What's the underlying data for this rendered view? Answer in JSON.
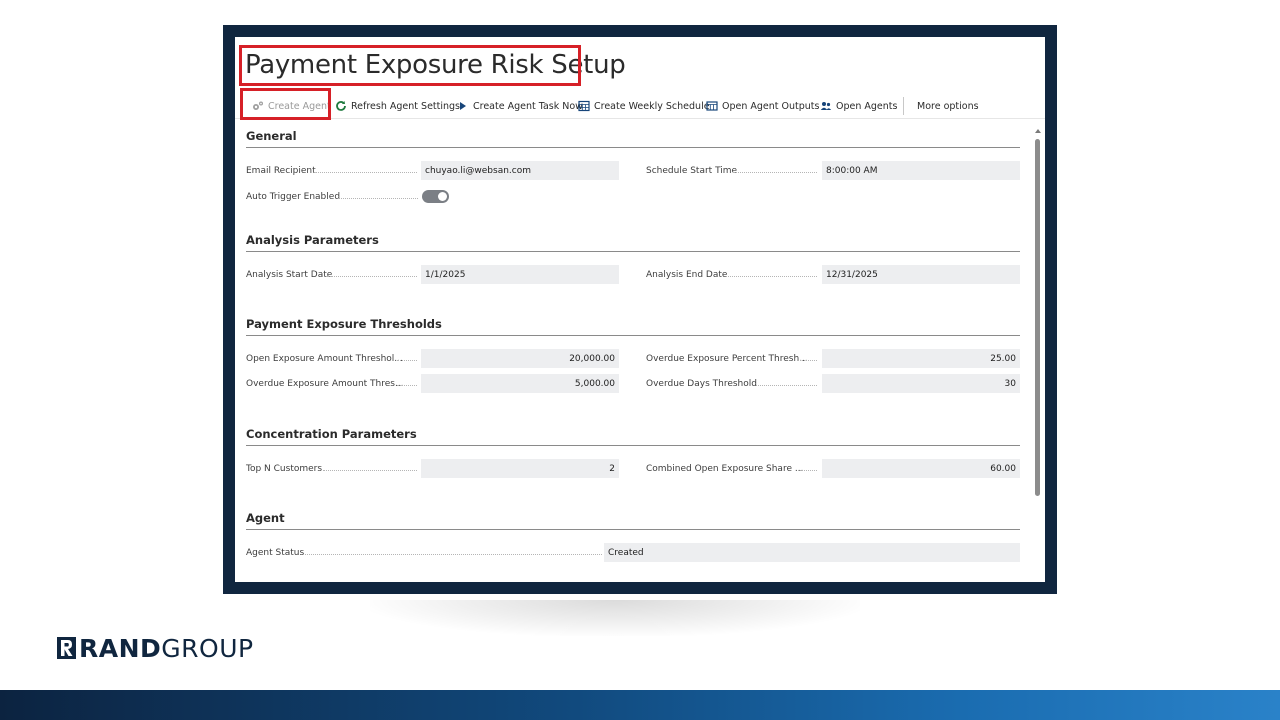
{
  "page": {
    "title": "Payment Exposure Risk Setup"
  },
  "actions": [
    {
      "label": "Create Agent",
      "icon": "agent-gear-icon",
      "disabled": true
    },
    {
      "label": "Refresh Agent Settings",
      "icon": "refresh-icon"
    },
    {
      "label": "Create Agent Task Now",
      "icon": "play-icon"
    },
    {
      "label": "Create Weekly Schedule",
      "icon": "calendar-icon"
    },
    {
      "label": "Open Agent Outputs",
      "icon": "table-icon"
    },
    {
      "label": "Open Agents",
      "icon": "people-icon"
    },
    {
      "label": "More options"
    }
  ],
  "sections": {
    "general": {
      "title": "General",
      "email_recipient": {
        "label": "Email Recipient",
        "value": "chuyao.li@websan.com"
      },
      "schedule_start_time": {
        "label": "Schedule Start Time",
        "value": "8:00:00 AM"
      },
      "auto_trigger_enabled": {
        "label": "Auto Trigger Enabled",
        "value": true
      }
    },
    "analysis": {
      "title": "Analysis Parameters",
      "start_date": {
        "label": "Analysis Start Date",
        "value": "1/1/2025"
      },
      "end_date": {
        "label": "Analysis End Date",
        "value": "12/31/2025"
      }
    },
    "thresholds": {
      "title": "Payment Exposure Thresholds",
      "open_amount": {
        "label": "Open Exposure Amount Threshol...",
        "value": "20,000.00"
      },
      "overdue_percent": {
        "label": "Overdue Exposure Percent Thresh...",
        "value": "25.00"
      },
      "overdue_amount": {
        "label": "Overdue Exposure Amount Thres...",
        "value": "5,000.00"
      },
      "overdue_days": {
        "label": "Overdue Days Threshold",
        "value": "30"
      }
    },
    "concentration": {
      "title": "Concentration Parameters",
      "top_n": {
        "label": "Top N Customers",
        "value": "2"
      },
      "combined_share": {
        "label": "Combined Open Exposure Share ...",
        "value": "60.00"
      }
    },
    "agent": {
      "title": "Agent",
      "status": {
        "label": "Agent Status",
        "value": "Created"
      }
    }
  },
  "brand": {
    "logo_text_bold": "RAND",
    "logo_text_light": "GROUP",
    "highlight_color": "#d62027",
    "frame_color": "#10263f"
  }
}
